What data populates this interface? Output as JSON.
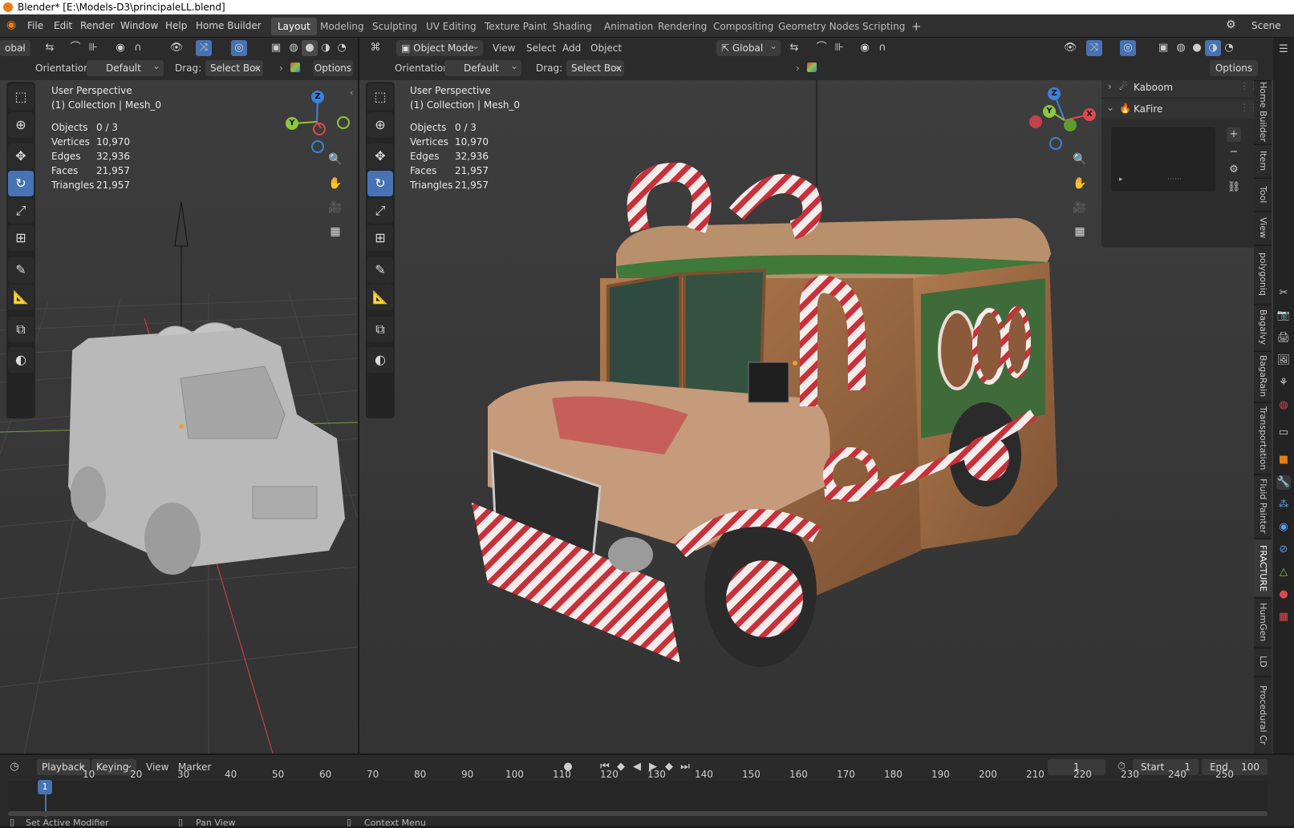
{
  "title": "Blender* [E:\\Models-D3\\principaleLL.blend]",
  "menu": [
    "File",
    "Edit",
    "Render",
    "Window",
    "Help",
    "Home Builder"
  ],
  "workspaces": [
    "Layout",
    "Modeling",
    "Sculpting",
    "UV Editing",
    "Texture Paint",
    "Shading",
    "Animation",
    "Rendering",
    "Compositing",
    "Geometry Nodes",
    "Scripting"
  ],
  "active_workspace": "Layout",
  "add_workspace": "+",
  "scene": "Scene",
  "left_header": {
    "transform": "obal",
    "orientation_label": "Orientation:",
    "orientation": "Default",
    "drag_label": "Drag:",
    "drag": "Select Box",
    "options": "Options"
  },
  "right_header": {
    "mode": "Object Mode",
    "menus": [
      "View",
      "Select",
      "Add",
      "Object"
    ],
    "transform": "Global",
    "orientation_label": "Orientation:",
    "orientation": "Default",
    "drag_label": "Drag:",
    "drag": "Select Box",
    "options": "Options"
  },
  "viewport": {
    "view_name": "User Perspective",
    "collection": "(1) Collection | Mesh_0",
    "stats": [
      {
        "label": "Objects",
        "value": "0 / 3"
      },
      {
        "label": "Vertices",
        "value": "10,970"
      },
      {
        "label": "Edges",
        "value": "32,936"
      },
      {
        "label": "Faces",
        "value": "21,957"
      },
      {
        "label": "Triangles",
        "value": "21,957"
      }
    ]
  },
  "gizmo": {
    "x": "X",
    "y": "Y",
    "z": "Z"
  },
  "addon_panel": {
    "items": [
      {
        "label": "Kaboom",
        "expanded": false
      },
      {
        "label": "KaFire",
        "expanded": true
      }
    ]
  },
  "sidebar_tabs": [
    "Home Builder",
    "Item",
    "Tool",
    "View",
    "polygoniq",
    "Bagalvy",
    "BagaRain",
    "Transportation",
    "Fluid Painter",
    "FRACTURE",
    "HumGen",
    "LD",
    "Procedural Cr"
  ],
  "timeline": {
    "menus": [
      "Playback",
      "Keying",
      "View",
      "Marker"
    ],
    "current_frame": "1",
    "start_label": "Start",
    "start": "1",
    "end_label": "End",
    "end": "100",
    "ticks": [
      "10",
      "20",
      "30",
      "40",
      "50",
      "60",
      "70",
      "80",
      "90",
      "100",
      "110",
      "120",
      "130",
      "140",
      "150",
      "160",
      "170",
      "180",
      "190",
      "200",
      "210",
      "220",
      "230",
      "240",
      "250"
    ],
    "playhead": "1"
  },
  "statusbar": [
    "Set Active Modifier",
    "Pan View",
    "Context Menu"
  ],
  "colors": {
    "accent": "#4772b3",
    "x_axis": "#e0474f",
    "y_axis": "#8ec63f",
    "z_axis": "#3b82d8"
  }
}
